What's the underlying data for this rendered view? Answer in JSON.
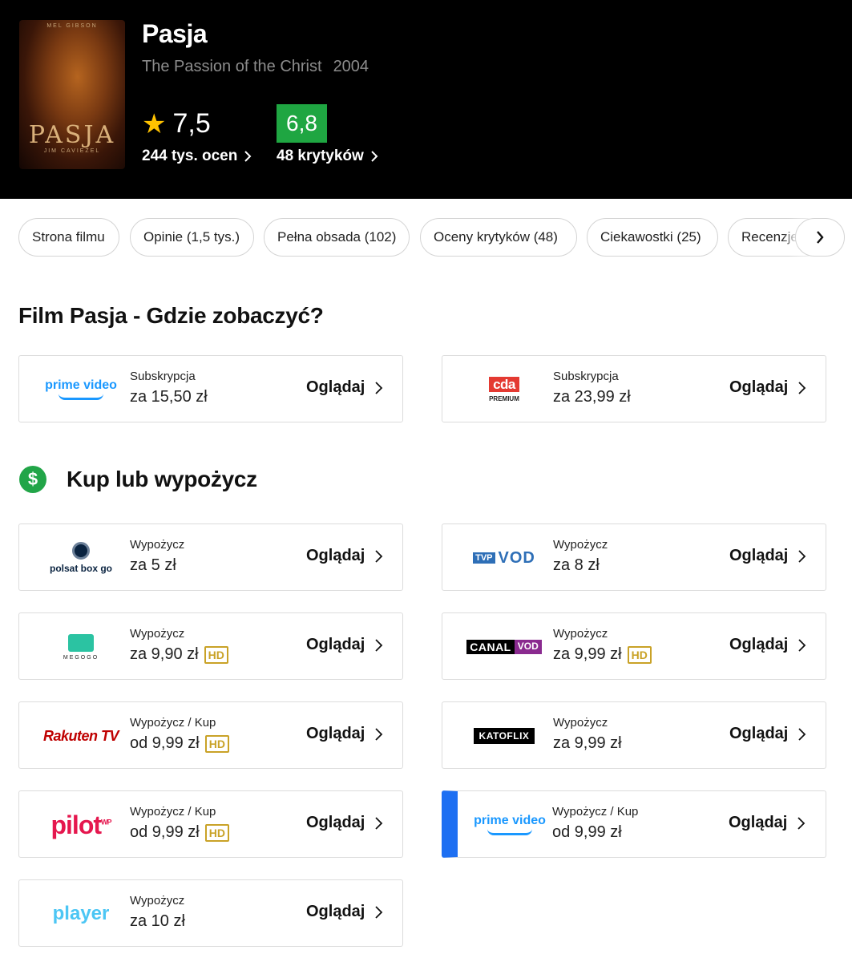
{
  "header": {
    "title": "Pasja",
    "original_title": "The Passion of the Christ",
    "year": "2004",
    "poster_title": "PASJA",
    "poster_top": "MEL GIBSON",
    "poster_actor": "JIM CAVIEZEL",
    "user_rating": "7,5",
    "user_count": "244 tys. ocen",
    "critic_rating": "6,8",
    "critic_count": "48 krytyków"
  },
  "tabs": [
    {
      "label": "Strona filmu"
    },
    {
      "label": "Opinie (1,5 tys.)"
    },
    {
      "label": "Pełna obsada (102)"
    },
    {
      "label": "Oceny krytyków (48)"
    },
    {
      "label": "Ciekawostki (25)"
    },
    {
      "label": "Recenzje"
    }
  ],
  "section_watch": {
    "heading": "Film Pasja - Gdzie zobaczyć?",
    "offers": [
      {
        "logo": "prime video",
        "type": "Subskrypcja",
        "price": "za 15,50 zł",
        "cta": "Oglądaj"
      },
      {
        "logo": "cda PREMIUM",
        "logo_main": "cda",
        "logo_sub": "PREMIUM",
        "type": "Subskrypcja",
        "price": "za 23,99 zł",
        "cta": "Oglądaj"
      }
    ]
  },
  "section_buy": {
    "icon": "dollar-icon",
    "icon_glyph": "$",
    "heading": "Kup lub wypożycz",
    "offers": [
      {
        "logo": "polsat box go",
        "type": "Wypożycz",
        "price": "za 5 zł",
        "cta": "Oglądaj"
      },
      {
        "logo": "TVP VOD",
        "logo_a": "TVP",
        "logo_b": "VOD",
        "type": "Wypożycz",
        "price": "za 8 zł",
        "cta": "Oglądaj"
      },
      {
        "logo": "MEGOGO",
        "type": "Wypożycz",
        "price": "za 9,90 zł",
        "badge": "HD",
        "cta": "Oglądaj"
      },
      {
        "logo": "CANAL VOD",
        "logo_a": "CANAL",
        "logo_b": "VOD",
        "type": "Wypożycz",
        "price": "za 9,99 zł",
        "badge": "HD",
        "cta": "Oglądaj"
      },
      {
        "logo": "Rakuten TV",
        "type": "Wypożycz / Kup",
        "price": "od 9,99 zł",
        "badge": "HD",
        "cta": "Oglądaj"
      },
      {
        "logo": "KATOFLIX",
        "type": "Wypożycz",
        "price": "za 9,99 zł",
        "cta": "Oglądaj"
      },
      {
        "logo": "pilot",
        "logo_sup": "WP",
        "type": "Wypożycz / Kup",
        "price": "od 9,99 zł",
        "badge": "HD",
        "cta": "Oglądaj"
      },
      {
        "logo": "prime video",
        "type": "Wypożycz / Kup",
        "price": "od 9,99 zł",
        "cta": "Oglądaj"
      },
      {
        "logo": "player",
        "type": "Wypożycz",
        "price": "za 10 zł",
        "cta": "Oglądaj"
      }
    ]
  },
  "colors": {
    "critic_green": "#1fa642",
    "star_yellow": "#ffc200",
    "hd_gold": "#c9a227",
    "dollar_green": "#22a548",
    "prime_accent": "#1d6ff2"
  }
}
